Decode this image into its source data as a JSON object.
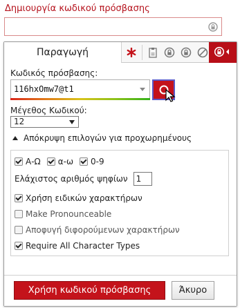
{
  "page": {
    "label": "Δημιουργία κωδικού πρόσβασης"
  },
  "tabs": {
    "generate_label": "Παραγωγή",
    "icons": [
      "asterisk-icon",
      "clipboard-icon",
      "lock-history-icon",
      "lock-icon",
      "block-icon",
      "lock-active-icon"
    ]
  },
  "password": {
    "label": "Κωδικός πρόσβασης:",
    "value": "116hxOmw7@t1"
  },
  "length": {
    "label": "Μέγεθος Κωδικού:",
    "value": "12"
  },
  "advanced": {
    "toggle_label": "Απόκρυψη επιλογών για προχωρημένους",
    "charsets": [
      {
        "label": "Α-Ω",
        "checked": true
      },
      {
        "label": "α-ω",
        "checked": true
      },
      {
        "label": "0-9",
        "checked": true
      }
    ],
    "min_digits_label": "Ελάχιστος αριθμός ψηφίων",
    "min_digits_value": "1",
    "special_label": "Χρήση ειδικών χαρακτήρων",
    "pronounceable_label": "Make Pronounceable",
    "avoid_ambiguous_label": "Αποφυγή διφορούμενων χαρακτήρων",
    "require_all_label": "Require All Character Types"
  },
  "footer": {
    "use_label": "Χρήση κωδικού πρόσβασης",
    "cancel_label": "Άκυρο"
  },
  "colors": {
    "accent": "#c4131b",
    "label_red": "#b5111b"
  }
}
